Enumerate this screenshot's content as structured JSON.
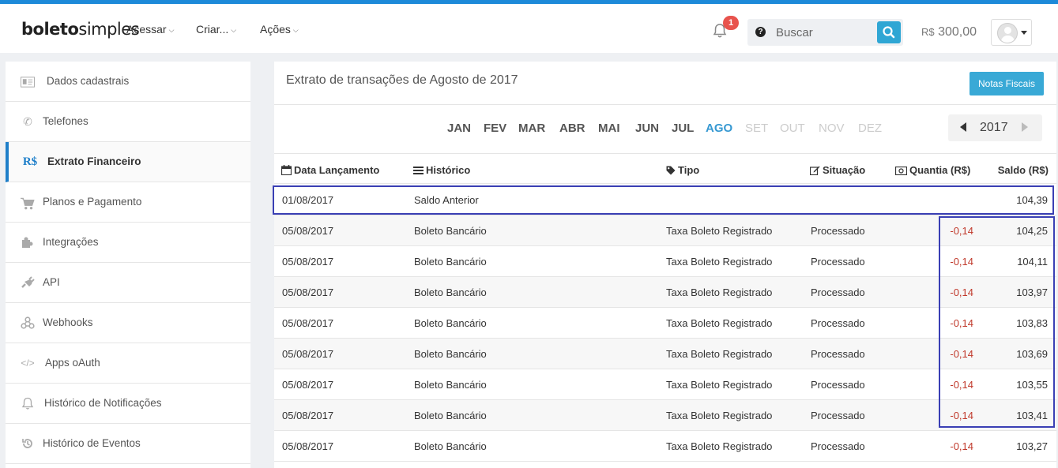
{
  "header": {
    "logo_bold": "boleto",
    "logo_light": "simples",
    "nav": [
      {
        "label": "Acessar"
      },
      {
        "label": "Criar..."
      },
      {
        "label": "Ações"
      }
    ],
    "notifications_count": "1",
    "search_placeholder": "Buscar",
    "search_help": "?",
    "balance_currency": "R$",
    "balance_value": "300,00"
  },
  "sidebar": {
    "items": [
      {
        "label": "Dados cadastrais",
        "icon": "id-card-icon"
      },
      {
        "label": "Telefones",
        "icon": "phone-icon"
      },
      {
        "label": "Extrato Financeiro",
        "icon": "currency-icon",
        "glyph": "R$"
      },
      {
        "label": "Planos e Pagamento",
        "icon": "cart-icon"
      },
      {
        "label": "Integrações",
        "icon": "puzzle-icon"
      },
      {
        "label": "API",
        "icon": "plug-icon"
      },
      {
        "label": "Webhooks",
        "icon": "webhook-icon"
      },
      {
        "label": "Apps oAuth",
        "icon": "code-icon"
      },
      {
        "label": "Histórico de Notificações",
        "icon": "bell-icon"
      },
      {
        "label": "Histórico de Eventos",
        "icon": "history-icon"
      }
    ]
  },
  "main": {
    "title": "Extrato de transações de Agosto de 2017",
    "notas_button": "Notas Fiscais",
    "months": [
      "JAN",
      "FEV",
      "MAR",
      "ABR",
      "MAI",
      "JUN",
      "JUL",
      "AGO",
      "SET",
      "OUT",
      "NOV",
      "DEZ"
    ],
    "current_month": "AGO",
    "year": "2017",
    "columns": {
      "date": "Data Lançamento",
      "history": "Histórico",
      "type": "Tipo",
      "status": "Situação",
      "amount": "Quantia (R$)",
      "balance": "Saldo (R$)"
    },
    "rows": [
      {
        "date": "01/08/2017",
        "history": "Saldo Anterior",
        "type": "",
        "status": "",
        "amount": "",
        "balance": "104,39"
      },
      {
        "date": "05/08/2017",
        "history": "Boleto Bancário",
        "type": "Taxa Boleto Registrado",
        "status": "Processado",
        "amount": "-0,14",
        "balance": "104,25"
      },
      {
        "date": "05/08/2017",
        "history": "Boleto Bancário",
        "type": "Taxa Boleto Registrado",
        "status": "Processado",
        "amount": "-0,14",
        "balance": "104,11"
      },
      {
        "date": "05/08/2017",
        "history": "Boleto Bancário",
        "type": "Taxa Boleto Registrado",
        "status": "Processado",
        "amount": "-0,14",
        "balance": "103,97"
      },
      {
        "date": "05/08/2017",
        "history": "Boleto Bancário",
        "type": "Taxa Boleto Registrado",
        "status": "Processado",
        "amount": "-0,14",
        "balance": "103,83"
      },
      {
        "date": "05/08/2017",
        "history": "Boleto Bancário",
        "type": "Taxa Boleto Registrado",
        "status": "Processado",
        "amount": "-0,14",
        "balance": "103,69"
      },
      {
        "date": "05/08/2017",
        "history": "Boleto Bancário",
        "type": "Taxa Boleto Registrado",
        "status": "Processado",
        "amount": "-0,14",
        "balance": "103,55"
      },
      {
        "date": "05/08/2017",
        "history": "Boleto Bancário",
        "type": "Taxa Boleto Registrado",
        "status": "Processado",
        "amount": "-0,14",
        "balance": "103,41"
      },
      {
        "date": "05/08/2017",
        "history": "Boleto Bancário",
        "type": "Taxa Boleto Registrado",
        "status": "Processado",
        "amount": "-0,14",
        "balance": "103,27"
      }
    ]
  },
  "colors": {
    "accent": "#1d8ad9",
    "negative": "#c0392b",
    "highlight": "#3a3fb4"
  }
}
